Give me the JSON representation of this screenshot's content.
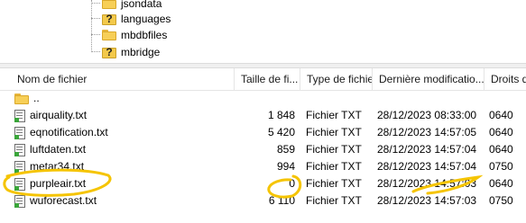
{
  "tree": {
    "items": [
      {
        "label": "jsondata",
        "icon": "folder-icon"
      },
      {
        "label": "languages",
        "icon": "unknown-folder-icon"
      },
      {
        "label": "mbdbfiles",
        "icon": "folder-icon"
      },
      {
        "label": "mbridge",
        "icon": "unknown-folder-icon"
      }
    ]
  },
  "list": {
    "columns": [
      "Nom de fichier",
      "Taille de fi...",
      "Type de fichier",
      "Dernière modificatio...",
      "Droits d"
    ],
    "parent_label": "..",
    "rows": [
      {
        "name": "airquality.txt",
        "size": "1 848",
        "type": "Fichier TXT",
        "modified": "28/12/2023 08:33:00",
        "perms": "0640"
      },
      {
        "name": "eqnotification.txt",
        "size": "5 420",
        "type": "Fichier TXT",
        "modified": "28/12/2023 14:57:05",
        "perms": "0640"
      },
      {
        "name": "luftdaten.txt",
        "size": "859",
        "type": "Fichier TXT",
        "modified": "28/12/2023 14:57:04",
        "perms": "0640"
      },
      {
        "name": "metar34.txt",
        "size": "994",
        "type": "Fichier TXT",
        "modified": "28/12/2023 14:57:04",
        "perms": "0750"
      },
      {
        "name": "purpleair.txt",
        "size": "0",
        "type": "Fichier TXT",
        "modified": "28/12/2023 14:57:03",
        "perms": "0640"
      },
      {
        "name": "wuforecast.txt",
        "size": "6 110",
        "type": "Fichier TXT",
        "modified": "28/12/2023 14:57:03",
        "perms": "0750"
      }
    ]
  },
  "colors": {
    "annotation": "#f5c400",
    "folder": "#f7cf57",
    "file_badge": "#3aa53a"
  }
}
